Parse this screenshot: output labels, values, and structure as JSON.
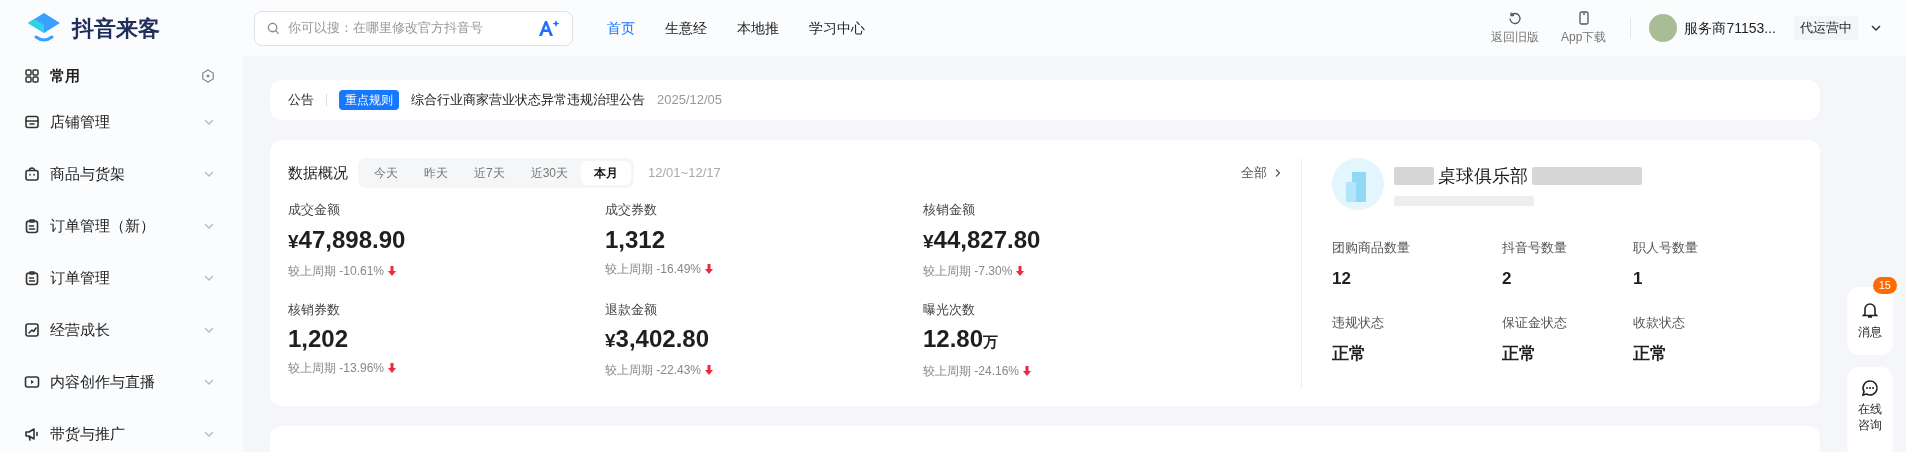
{
  "header": {
    "brand": "抖音来客",
    "search": {
      "placeholder": "你可以搜：在哪里修改官方抖音号"
    },
    "nav": [
      {
        "label": "首页",
        "selected": true
      },
      {
        "label": "生意经",
        "selected": false
      },
      {
        "label": "本地推",
        "selected": false
      },
      {
        "label": "学习中心",
        "selected": false
      }
    ],
    "actions": [
      {
        "kind": "revert",
        "label": "返回旧版"
      },
      {
        "kind": "phone",
        "label": "App下载"
      }
    ],
    "account": {
      "name": "服务商71153...",
      "status": "代运营中"
    }
  },
  "sidebar": {
    "pinned": {
      "label": "常用"
    },
    "items": [
      {
        "kind": "store",
        "label": "店铺管理",
        "expanded": false
      },
      {
        "kind": "bag",
        "label": "商品与货架",
        "expanded": false
      },
      {
        "kind": "clipboard",
        "label": "订单管理（新）",
        "expanded": false
      },
      {
        "kind": "clipboard",
        "label": "订单管理",
        "expanded": false
      },
      {
        "kind": "chart",
        "label": "经营成长",
        "expanded": false
      },
      {
        "kind": "play",
        "label": "内容创作与直播",
        "expanded": false
      },
      {
        "kind": "megaphone",
        "label": "带货与推广",
        "expanded": false
      }
    ]
  },
  "notice": {
    "label": "公告",
    "tag": "重点规则",
    "text": "综合行业商家营业状态异常违规治理公告",
    "date": "2025/12/05"
  },
  "overview": {
    "title": "数据概况",
    "periods": [
      {
        "label": "今天",
        "selected": false
      },
      {
        "label": "昨天",
        "selected": false
      },
      {
        "label": "近7天",
        "selected": false
      },
      {
        "label": "近30天",
        "selected": false
      },
      {
        "label": "本月",
        "selected": true
      }
    ],
    "range": "12/01~12/17",
    "all_link": "全部",
    "metrics": [
      {
        "label": "成交金额",
        "prefix": "¥",
        "value": "47,898.90",
        "compare": "较上周期 -10.61%"
      },
      {
        "label": "成交券数",
        "value": "1,312",
        "compare": "较上周期 -16.49%"
      },
      {
        "label": "核销金额",
        "prefix": "¥",
        "value": "44,827.80",
        "compare": "较上周期 -7.30%"
      },
      {
        "label": "核销券数",
        "value": "1,202",
        "compare": "较上周期 -13.96%"
      },
      {
        "label": "退款金额",
        "prefix": "¥",
        "value": "3,402.80",
        "compare": "较上周期 -22.43%"
      },
      {
        "label": "曝光次数",
        "value": "12.80",
        "unit": "万",
        "compare": "较上周期 -24.16%"
      }
    ]
  },
  "shop": {
    "name": "桌球俱乐部",
    "stats": [
      {
        "label": "团购商品数量",
        "value": "12"
      },
      {
        "label": "抖音号数量",
        "value": "2"
      },
      {
        "label": "职人号数量",
        "value": "1"
      },
      {
        "label": "违规状态",
        "value": "正常"
      },
      {
        "label": "保证金状态",
        "value": "正常"
      },
      {
        "label": "收款状态",
        "value": "正常"
      }
    ]
  },
  "float": {
    "messages": {
      "label": "消息",
      "badge": "15"
    },
    "chat": {
      "label": "在线咨询"
    }
  }
}
